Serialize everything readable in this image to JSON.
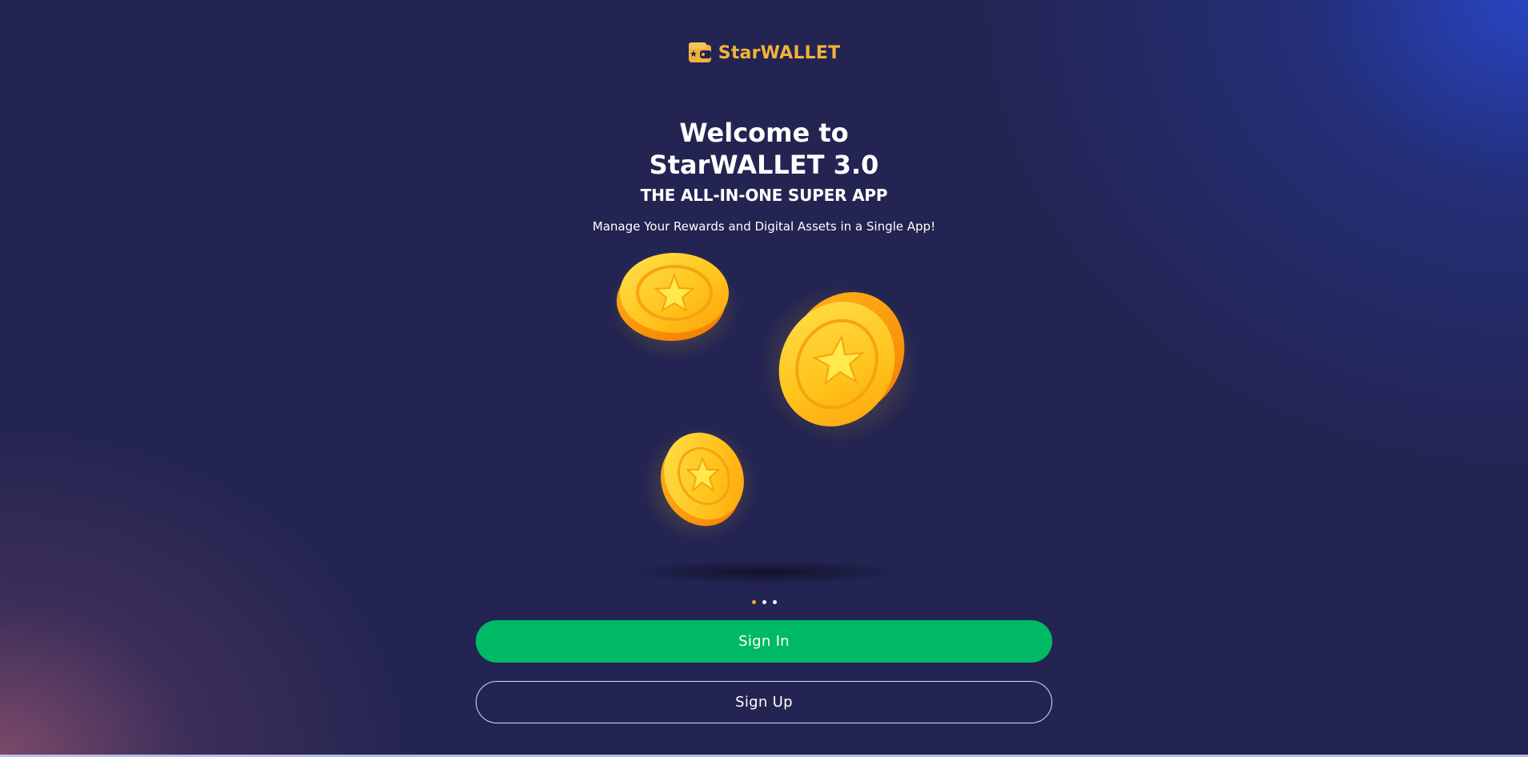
{
  "brand": {
    "name": "StarWALLET",
    "logo_icon": "wallet-icon",
    "color": "#f0b33a"
  },
  "welcome": {
    "title_line1": "Welcome to",
    "title_line2": "StarWALLET 3.0",
    "subtitle": "THE ALL-IN-ONE SUPER APP",
    "tagline": "Manage Your Rewards and Digital Assets in a Single App!"
  },
  "illustration": {
    "icon": "star-coins-illustration",
    "coin_color": "#ffc21a"
  },
  "carousel": {
    "total": 3,
    "active_index": 0,
    "active_color": "#f0a830"
  },
  "actions": {
    "sign_in": "Sign In",
    "sign_up": "Sign Up",
    "sign_in_color": "#00b964"
  },
  "colors": {
    "background": "#232451"
  }
}
